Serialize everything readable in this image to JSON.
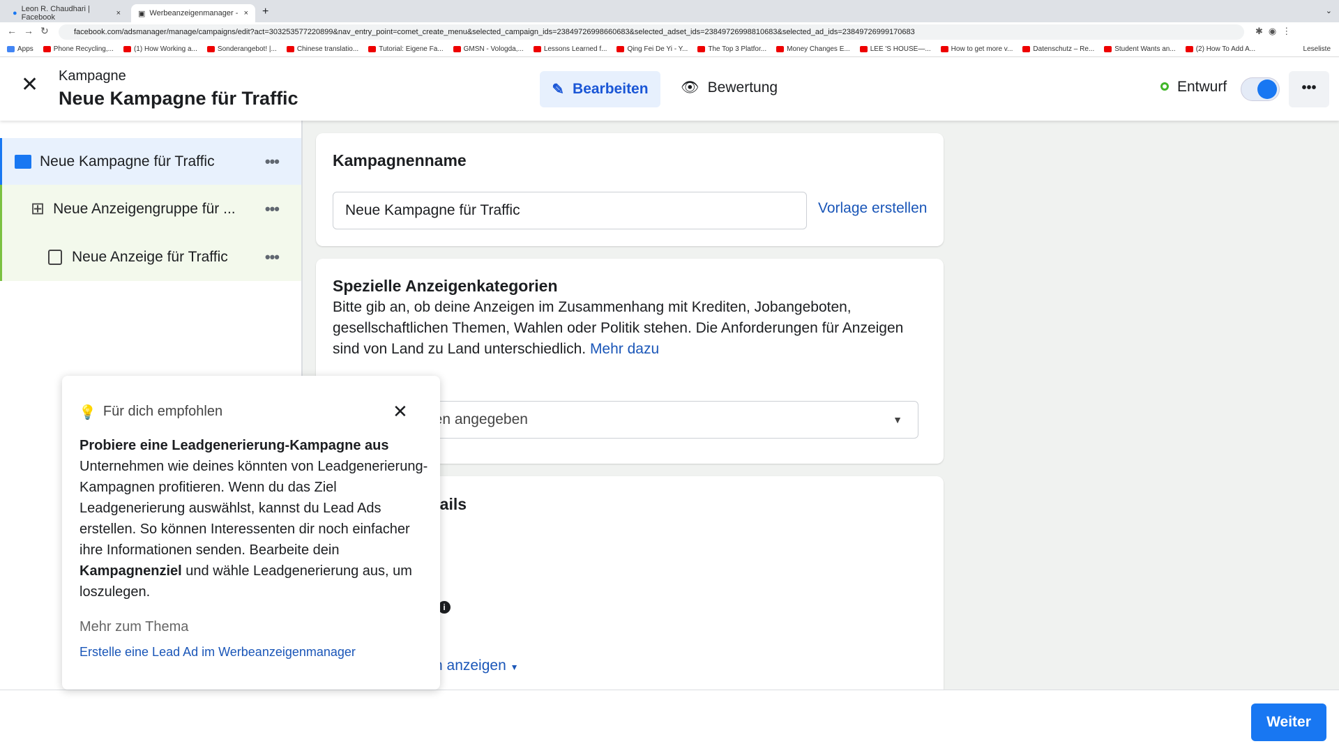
{
  "browser": {
    "tabs": [
      {
        "label": "Leon R. Chaudhari | Facebook"
      },
      {
        "label": "Werbeanzeigenmanager - Wer"
      }
    ],
    "url": "facebook.com/adsmanager/manage/campaigns/edit?act=303253577220899&nav_entry_point=comet_create_menu&selected_campaign_ids=23849726998660683&selected_adset_ids=23849726998810683&selected_ad_ids=23849726999170683",
    "bookmarks": [
      "Apps",
      "Phone Recycling,...",
      "(1) How Working a...",
      "Sonderangebot! |...",
      "Chinese translatio...",
      "Tutorial: Eigene Fa...",
      "GMSN - Vologda,...",
      "Lessons Learned f...",
      "Qing Fei De Yi - Y...",
      "The Top 3 Platfor...",
      "Money Changes E...",
      "LEE 'S HOUSE—...",
      "How to get more v...",
      "Datenschutz – Re...",
      "Student Wants an...",
      "(2) How To Add A..."
    ],
    "reading_list": "Leseliste"
  },
  "header": {
    "subtitle": "Kampagne",
    "title": "Neue Kampagne für Traffic",
    "edit_label": "Bearbeiten",
    "review_label": "Bewertung",
    "status": "Entwurf",
    "toggle_on": true,
    "accent": "#1877f2",
    "status_color": "#42b72a"
  },
  "sidebar": {
    "items": [
      {
        "label": "Neue Kampagne für Traffic",
        "icon": "folder-icon"
      },
      {
        "label": "Neue Anzeigengruppe für ...",
        "icon": "grid-icon"
      },
      {
        "label": "Neue Anzeige für Traffic",
        "icon": "ad-icon"
      }
    ]
  },
  "main": {
    "name_card": {
      "title": "Kampagnenname",
      "value": "Neue Kampagne für Traffic",
      "template_link": "Vorlage erstellen"
    },
    "categories_card": {
      "title": "Spezielle Anzeigenkategorien",
      "description": "Bitte gib an, ob deine Anzeigen im Zusammenhang mit Krediten, Jobangeboten, gesellschaftlichen Themen, Wahlen oder Politik stehen. Die Anforderungen für Anzeigen sind von Land zu Land unterschiedlich.",
      "more_link": "Mehr dazu",
      "select_value": "ien angegeben"
    },
    "details_card": {
      "title_partial": "tails",
      "more_partial": "n anzeigen"
    }
  },
  "popup": {
    "header": "Für dich empfohlen",
    "title": "Probiere eine Leadgenerierung-Kampagne aus",
    "body_1": "Unternehmen wie deines könnten von Leadgenerierung-Kampagnen profitieren. Wenn du das Ziel Leadgenerierung auswählst, kannst du Lead Ads erstellen. So können Interessenten dir noch einfacher ihre Informationen senden. Bearbeite dein",
    "body_bold": "Kampagnenziel",
    "body_2": "und wähle Leadgenerierung aus, um loszulegen.",
    "more_heading": "Mehr zum Thema",
    "link": "Erstelle eine Lead Ad im Werbeanzeigenmanager"
  },
  "footer": {
    "next_label": "Weiter"
  }
}
